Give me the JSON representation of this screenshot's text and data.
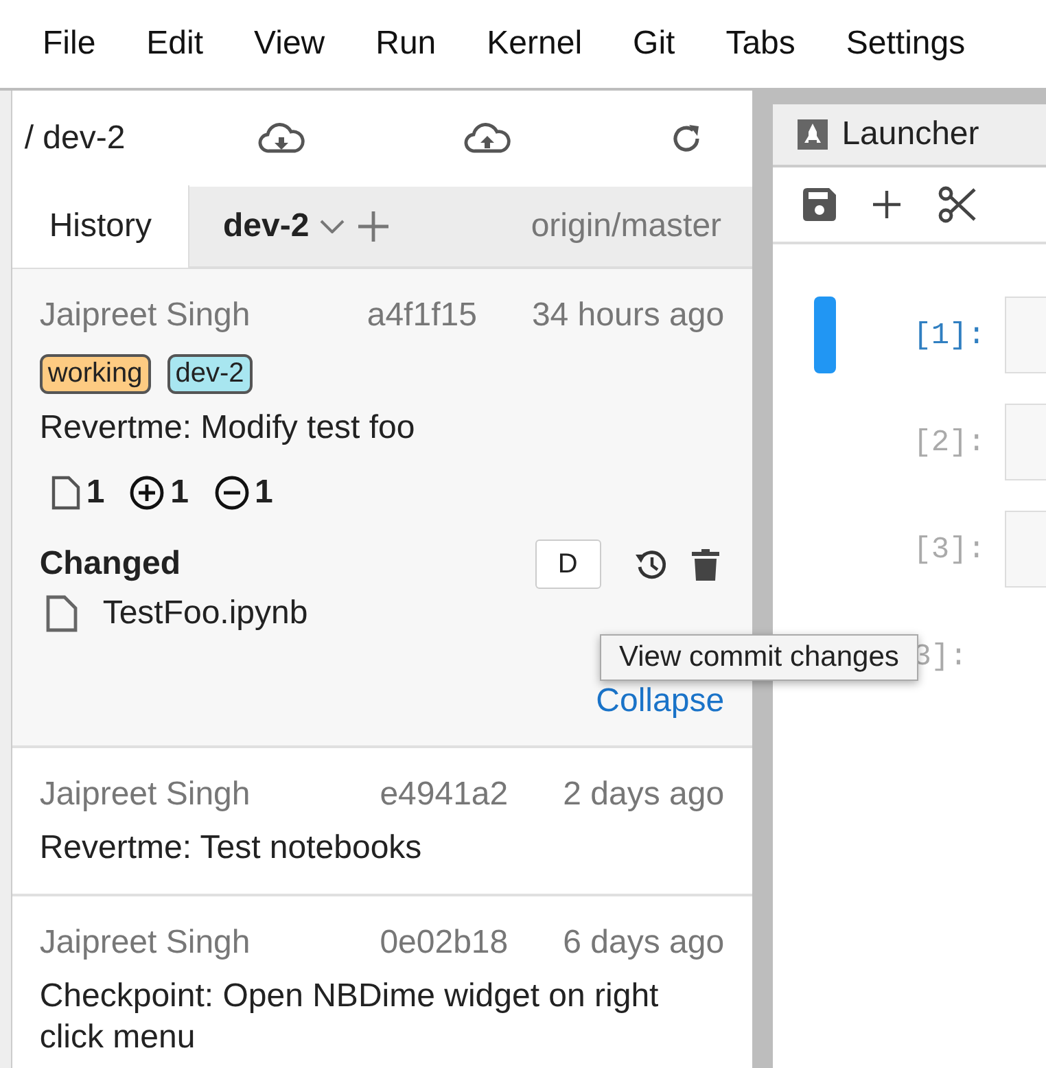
{
  "menu": [
    "File",
    "Edit",
    "View",
    "Run",
    "Kernel",
    "Git",
    "Tabs",
    "Settings"
  ],
  "git_panel": {
    "path": "/ dev-2",
    "tabs": [
      {
        "label": "History",
        "selected": true
      }
    ],
    "branch": "dev-2",
    "remote": "origin/master",
    "commits": [
      {
        "author": "Jaipreet Singh",
        "hash": "a4f1f15",
        "time": "34 hours ago",
        "expanded": true,
        "tags": [
          {
            "label": "working",
            "color": "#fdcb82"
          },
          {
            "label": "dev-2",
            "color": "#a8e6f0"
          }
        ],
        "message": "Revertme: Modify test foo",
        "stats": {
          "files": "1",
          "insertions": "1",
          "deletions": "1"
        },
        "changed_heading": "Changed",
        "files": [
          {
            "name": "TestFoo.ipynb",
            "action": "D"
          }
        ],
        "collapse": "Collapse"
      },
      {
        "author": "Jaipreet Singh",
        "hash": "e4941a2",
        "time": "2 days ago",
        "expanded": false,
        "message": "Revertme: Test notebooks"
      },
      {
        "author": "Jaipreet Singh",
        "hash": "0e02b18",
        "time": "6 days ago",
        "expanded": false,
        "message": "Checkpoint: Open NBDime widget on right click menu"
      }
    ]
  },
  "tooltip": "View commit changes",
  "notebook": {
    "tab": "Launcher",
    "cells": [
      {
        "prompt": "[1]:",
        "active": true,
        "editor": true
      },
      {
        "prompt": "[2]:",
        "active": false,
        "editor": true
      },
      {
        "prompt": "[3]:",
        "active": false,
        "editor": true
      },
      {
        "prompt": "3]:",
        "active": false,
        "editor": false
      }
    ]
  }
}
